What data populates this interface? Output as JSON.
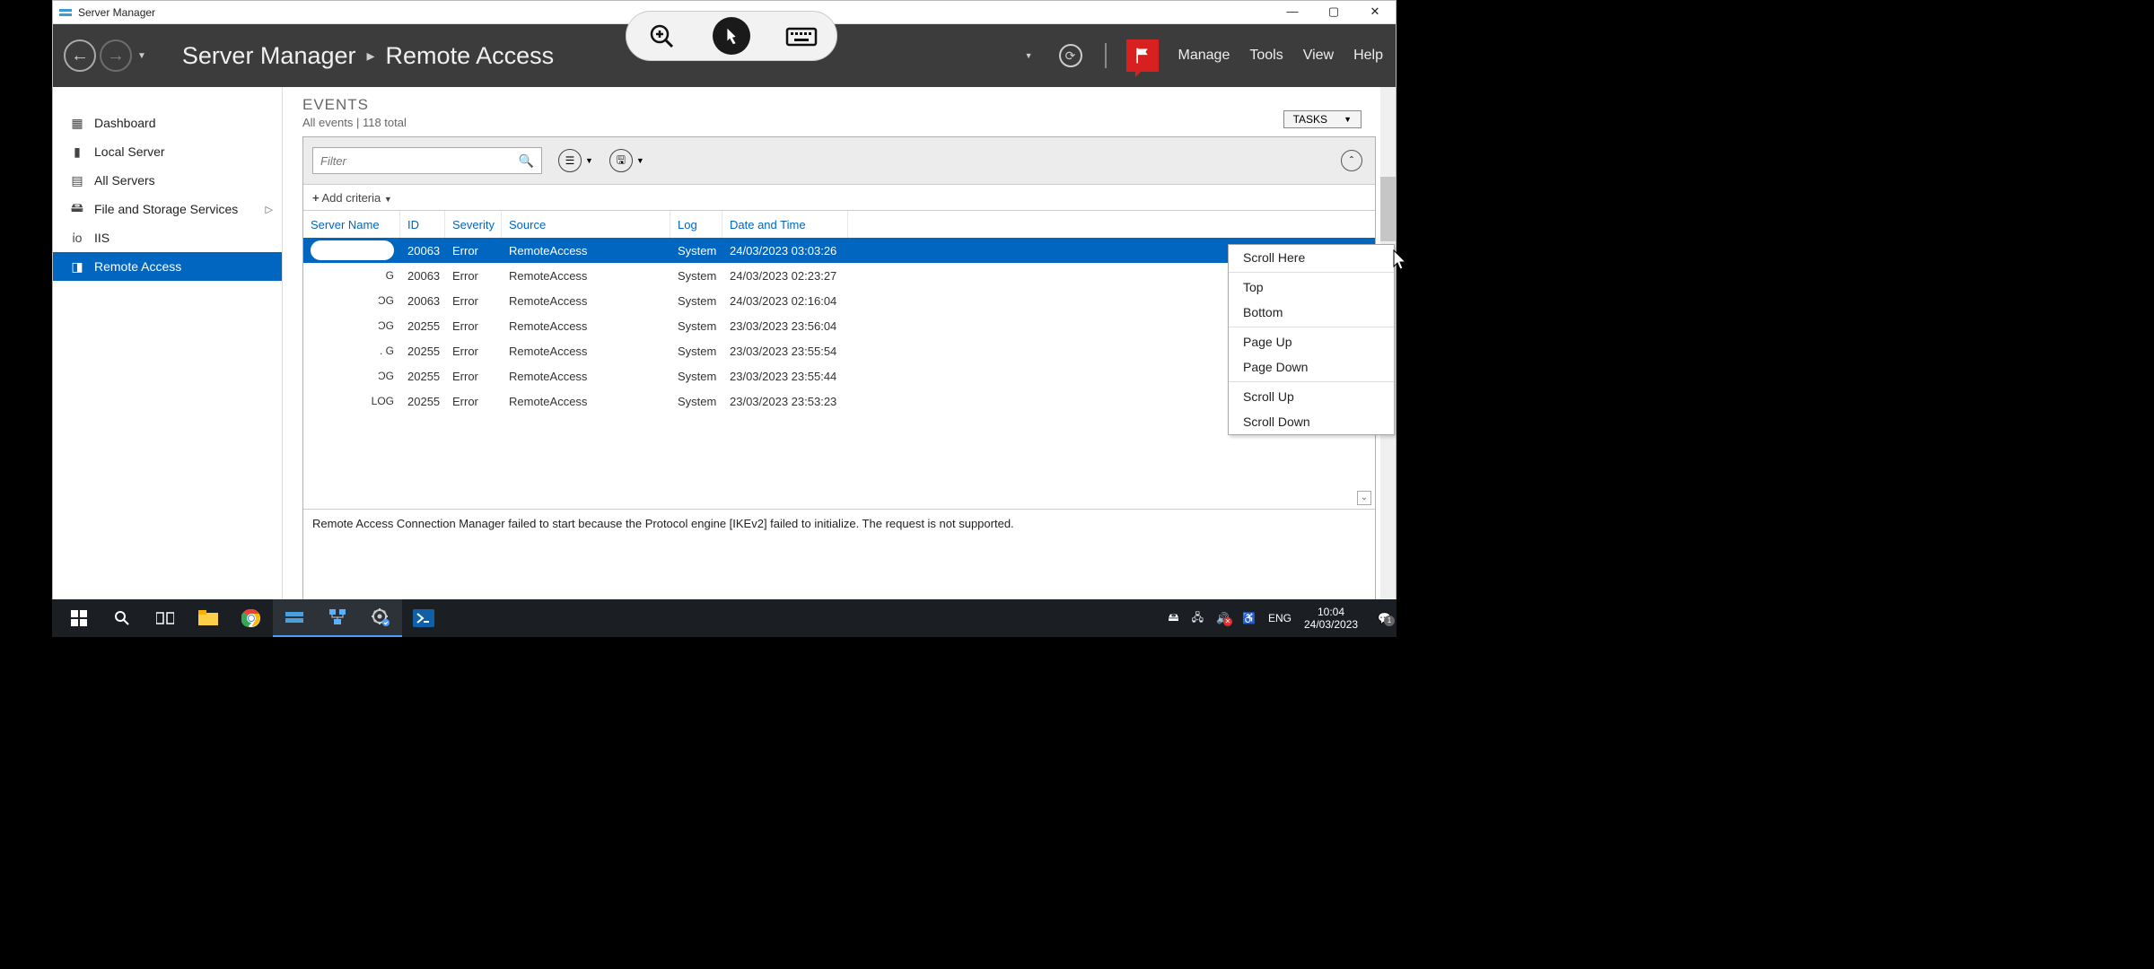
{
  "titlebar": {
    "app_title": "Server Manager"
  },
  "win_controls": [
    "—",
    "▢",
    "✕"
  ],
  "ribbon": {
    "breadcrumb": [
      "Server Manager",
      "Remote Access"
    ],
    "menu": [
      "Manage",
      "Tools",
      "View",
      "Help"
    ]
  },
  "sidebar": {
    "items": [
      {
        "label": "Dashboard",
        "icon": "dashboard"
      },
      {
        "label": "Local Server",
        "icon": "server"
      },
      {
        "label": "All Servers",
        "icon": "servers"
      },
      {
        "label": "File and Storage Services",
        "icon": "disk",
        "chev": true
      },
      {
        "label": "IIS",
        "icon": "iis"
      },
      {
        "label": "Remote Access",
        "icon": "remote",
        "active": true
      }
    ]
  },
  "events": {
    "title": "EVENTS",
    "subtitle": "All events | 118 total",
    "tasks": "TASKS",
    "filter_placeholder": "Filter",
    "add_criteria": "Add criteria",
    "columns": [
      "Server Name",
      "ID",
      "Severity",
      "Source",
      "Log",
      "Date and Time"
    ],
    "rows": [
      {
        "name": "",
        "id": "20063",
        "sev": "Error",
        "src": "RemoteAccess",
        "log": "System",
        "date": "24/03/2023 03:03:26",
        "sel": true
      },
      {
        "name": "G",
        "id": "20063",
        "sev": "Error",
        "src": "RemoteAccess",
        "log": "System",
        "date": "24/03/2023 02:23:27"
      },
      {
        "name": "ƆG",
        "id": "20063",
        "sev": "Error",
        "src": "RemoteAccess",
        "log": "System",
        "date": "24/03/2023 02:16:04"
      },
      {
        "name": "ƆG",
        "id": "20255",
        "sev": "Error",
        "src": "RemoteAccess",
        "log": "System",
        "date": "23/03/2023 23:56:04"
      },
      {
        "name": ". G",
        "id": "20255",
        "sev": "Error",
        "src": "RemoteAccess",
        "log": "System",
        "date": "23/03/2023 23:55:54"
      },
      {
        "name": "ƆG",
        "id": "20255",
        "sev": "Error",
        "src": "RemoteAccess",
        "log": "System",
        "date": "23/03/2023 23:55:44"
      },
      {
        "name": "LOG",
        "id": "20255",
        "sev": "Error",
        "src": "RemoteAccess",
        "log": "System",
        "date": "23/03/2023 23:53:23"
      }
    ],
    "detail": "Remote Access Connection Manager failed to start because the Protocol engine [IKEv2] failed to initialize. The request is not supported."
  },
  "context_menu": [
    "Scroll Here",
    "Top",
    "Bottom",
    "Page Up",
    "Page Down",
    "Scroll Up",
    "Scroll Down"
  ],
  "context_divs": [
    1,
    3,
    5
  ],
  "taskbar": {
    "lang": "ENG",
    "time": "10:04",
    "date": "24/03/2023"
  }
}
